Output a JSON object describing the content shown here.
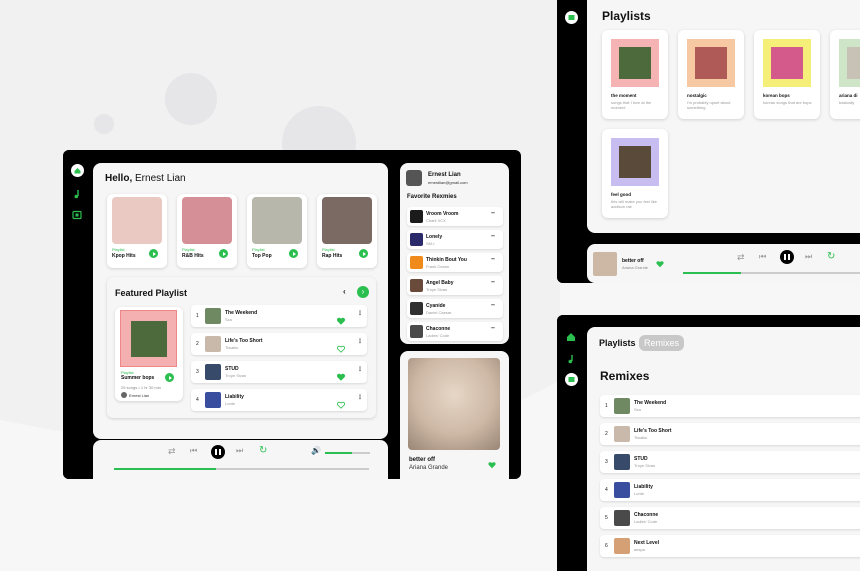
{
  "colors": {
    "accent": "#2bbf4f",
    "frame": "#000000",
    "panel": "#f6f6f6"
  },
  "main": {
    "greeting_prefix": "Hello,",
    "user_name": "Ernest Lian",
    "playlists": [
      {
        "tag": "Playlist",
        "title": "Kpop Hits",
        "color": "#e9c9c1"
      },
      {
        "tag": "Playlist",
        "title": "R&B Hits",
        "color": "#d58f96"
      },
      {
        "tag": "Playlist",
        "title": "Top Pop",
        "color": "#b7b7ac"
      },
      {
        "tag": "Playlist",
        "title": "Rap Hits",
        "color": "#7a6a63"
      }
    ],
    "featured": {
      "heading": "Featured Playlist",
      "tag": "Playlist",
      "title": "Summer bops",
      "meta": "25 songs • 1 hr 30 min",
      "owner": "Ernest Lian",
      "tracks": [
        {
          "n": "1",
          "title": "The Weekend",
          "artist": "Sza",
          "liked": true,
          "color": "#6f8a62"
        },
        {
          "n": "2",
          "title": "Life's Too Short",
          "artist": "Tiwaiku",
          "liked": false,
          "color": "#c9b9aa"
        },
        {
          "n": "3",
          "title": "STUD",
          "artist": "Troye Sivan",
          "liked": true,
          "color": "#384a6a"
        },
        {
          "n": "4",
          "title": "Liability",
          "artist": "Lorde",
          "liked": false,
          "color": "#3a4ea0"
        }
      ]
    }
  },
  "side": {
    "name": "Ernest Lian",
    "email": "ernestlian@gmail.com",
    "remixes_heading": "Favorite Rexmies",
    "remixes": [
      {
        "title": "Vroom Vroom",
        "artist": "Charli XCX",
        "color": "#1b1b1b"
      },
      {
        "title": "Lonely",
        "artist": "SM-I",
        "color": "#2a2a6a"
      },
      {
        "title": "Thinkin Bout You",
        "artist": "Frank Ocean",
        "color": "#f08a1a"
      },
      {
        "title": "Angel Baby",
        "artist": "Troye Sivan",
        "color": "#6a4a3a"
      },
      {
        "title": "Cyanide",
        "artist": "Daniel Caesar",
        "color": "#303030"
      },
      {
        "title": "Chaconne",
        "artist": "Ladies' Code",
        "color": "#4a4a4a"
      }
    ],
    "now_title": "better off",
    "now_artist": "Ariana Grande"
  },
  "player": {
    "progress": 0.4,
    "volume": 0.6
  },
  "right_top": {
    "heading": "Playlists",
    "items": [
      {
        "title": "the moment",
        "desc": "songs that I love at the moment",
        "bg": "#f6b3b3",
        "art": "#4d6a3c"
      },
      {
        "title": "nostalgic",
        "desc": "i'm probably upset about something",
        "bg": "#f7c9a2",
        "art": "#b05a58"
      },
      {
        "title": "korean bops",
        "desc": "korean songs that are bops",
        "bg": "#f5ef7a",
        "art": "#d35a8a"
      },
      {
        "title": "ariana di",
        "desc": "basically",
        "bg": "#cfe5c7",
        "art": "#c8c1b5"
      },
      {
        "title": "feel good",
        "desc": "this will make you feel like addison rae",
        "bg": "#c7bdf0",
        "art": "#5a4a3a"
      }
    ],
    "now_title": "better off",
    "now_artist": "Ariana Grande",
    "progress": 0.3
  },
  "right_bottom": {
    "tab_playlists": "Playlists",
    "tab_remixes": "Remixes",
    "heading": "Remixes",
    "rows": [
      {
        "n": "1",
        "title": "The Weekend",
        "artist": "Sza",
        "color": "#6f8a62"
      },
      {
        "n": "2",
        "title": "Life's Too Short",
        "artist": "Tiwaiku",
        "color": "#c9b9aa"
      },
      {
        "n": "3",
        "title": "STUD",
        "artist": "Troye Sivan",
        "color": "#384a6a"
      },
      {
        "n": "4",
        "title": "Liability",
        "artist": "Lorde",
        "color": "#3a4ea0"
      },
      {
        "n": "5",
        "title": "Chaconne",
        "artist": "Ladies' Code",
        "color": "#4a4a4a"
      },
      {
        "n": "6",
        "title": "Next Level",
        "artist": "aespa",
        "color": "#d4a074"
      }
    ]
  }
}
